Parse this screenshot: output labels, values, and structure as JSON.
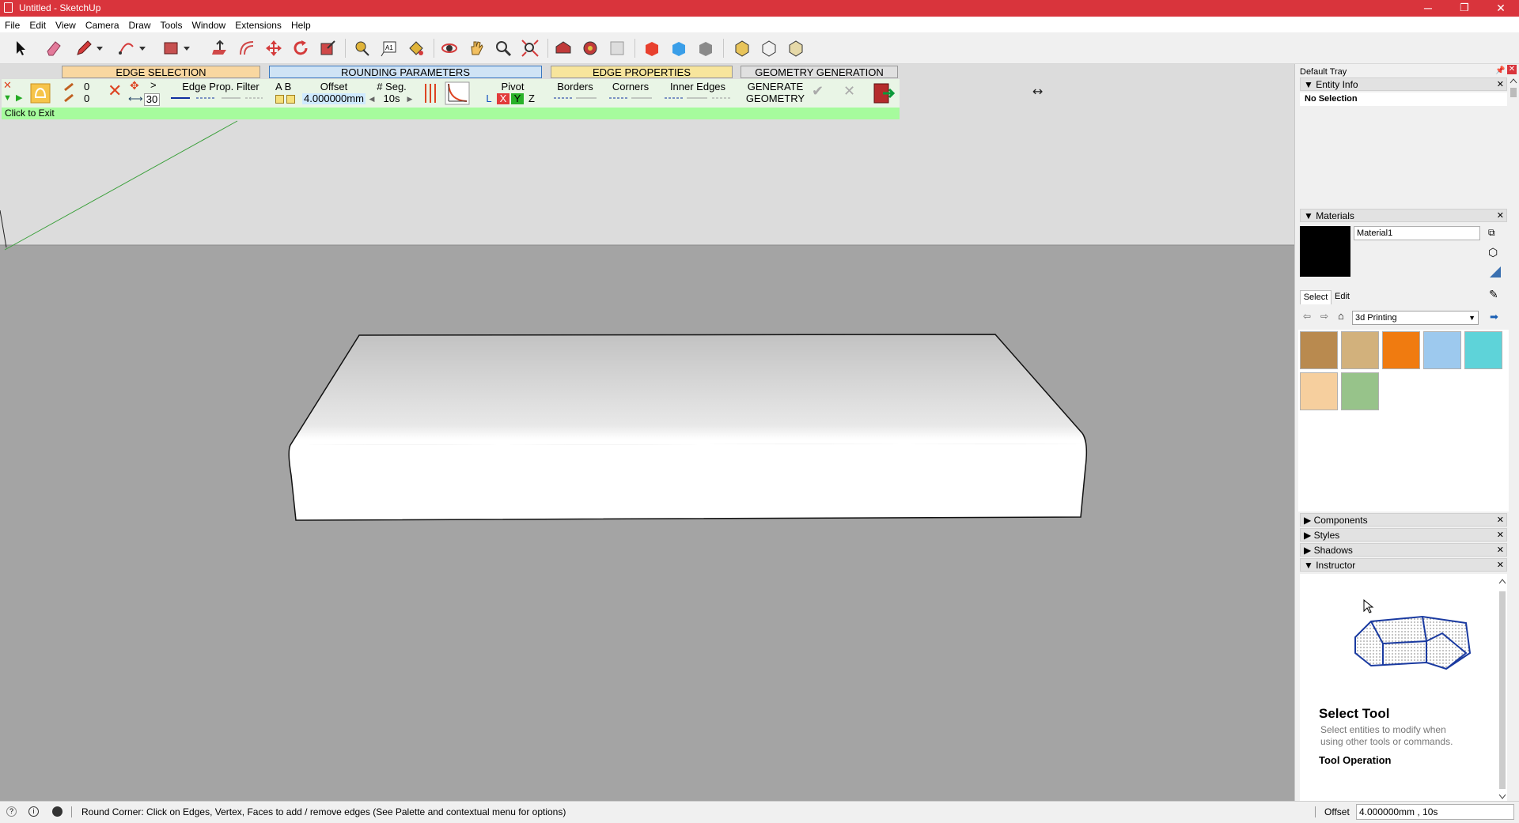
{
  "window": {
    "title": "Untitled - SketchUp",
    "minimize": "─",
    "maximize": "❐",
    "close": "✕"
  },
  "menu": [
    "File",
    "Edit",
    "View",
    "Camera",
    "Draw",
    "Tools",
    "Window",
    "Extensions",
    "Help"
  ],
  "toolbar_icons": [
    "select-tool",
    "eraser-tool",
    "pencil-tool",
    "pencil-dropdown",
    "arc-tool",
    "arc-dropdown",
    "rectangle-tool",
    "rectangle-dropdown",
    "push-pull-tool",
    "offset-tool",
    "move-tool",
    "rotate-tool",
    "scale-tool",
    "tape-measure-tool",
    "text-tool",
    "paint-bucket-tool",
    "orbit-tool",
    "pan-tool",
    "zoom-tool",
    "zoom-extents-tool",
    "warehouse-tool",
    "extension-warehouse-tool",
    "layout-tool",
    "solid-red-tool",
    "solid-blue-tool",
    "solid-grey-tool",
    "round-corner-tool",
    "round-corner-alt-tool",
    "round-corner-third-tool"
  ],
  "round_corner": {
    "headers": [
      "EDGE SELECTION",
      "ROUNDING PARAMETERS",
      "EDGE PROPERTIES",
      "GEOMETRY GENERATION"
    ],
    "count_a": "0",
    "count_b": "0",
    "angle": "30",
    "edge_prop_filter": "Edge Prop. Filter",
    "ab": "A  B",
    "offset_label": "Offset",
    "offset_value": "4.000000mm",
    "seg_label": "# Seg.",
    "seg_value": "10s",
    "pivot_label": "Pivot",
    "pivot_axes": [
      "L",
      "X",
      "Y",
      "Z"
    ],
    "borders": "Borders",
    "corners": "Corners",
    "inner_edges": "Inner Edges",
    "generate": [
      "GENERATE",
      "GEOMETRY"
    ],
    "exit_hint": "Click to Exit"
  },
  "tray": {
    "title": "Default Tray",
    "entity_info": {
      "label": "Entity Info",
      "selection": "No Selection"
    },
    "materials": {
      "label": "Materials",
      "name": "Material1",
      "tabs": [
        "Select",
        "Edit"
      ],
      "collection": "3d Printing",
      "swatches": [
        "#b98a4f",
        "#d2b17c",
        "#f07b10",
        "#9dc9ee",
        "#5ed3d9",
        "#f6cf9e",
        "#97c38a"
      ]
    },
    "collapsed": [
      "Components",
      "Styles",
      "Shadows"
    ],
    "instructor": {
      "label": "Instructor",
      "heading": "Select Tool",
      "desc": "Select entities to modify when using other tools or commands.",
      "section": "Tool Operation"
    }
  },
  "status": {
    "message": "Round Corner: Click on Edges, Vertex, Faces to add / remove edges (See Palette and contextual menu for options)",
    "measure_label": "Offset",
    "measure_value": "4.000000mm , 10s"
  }
}
